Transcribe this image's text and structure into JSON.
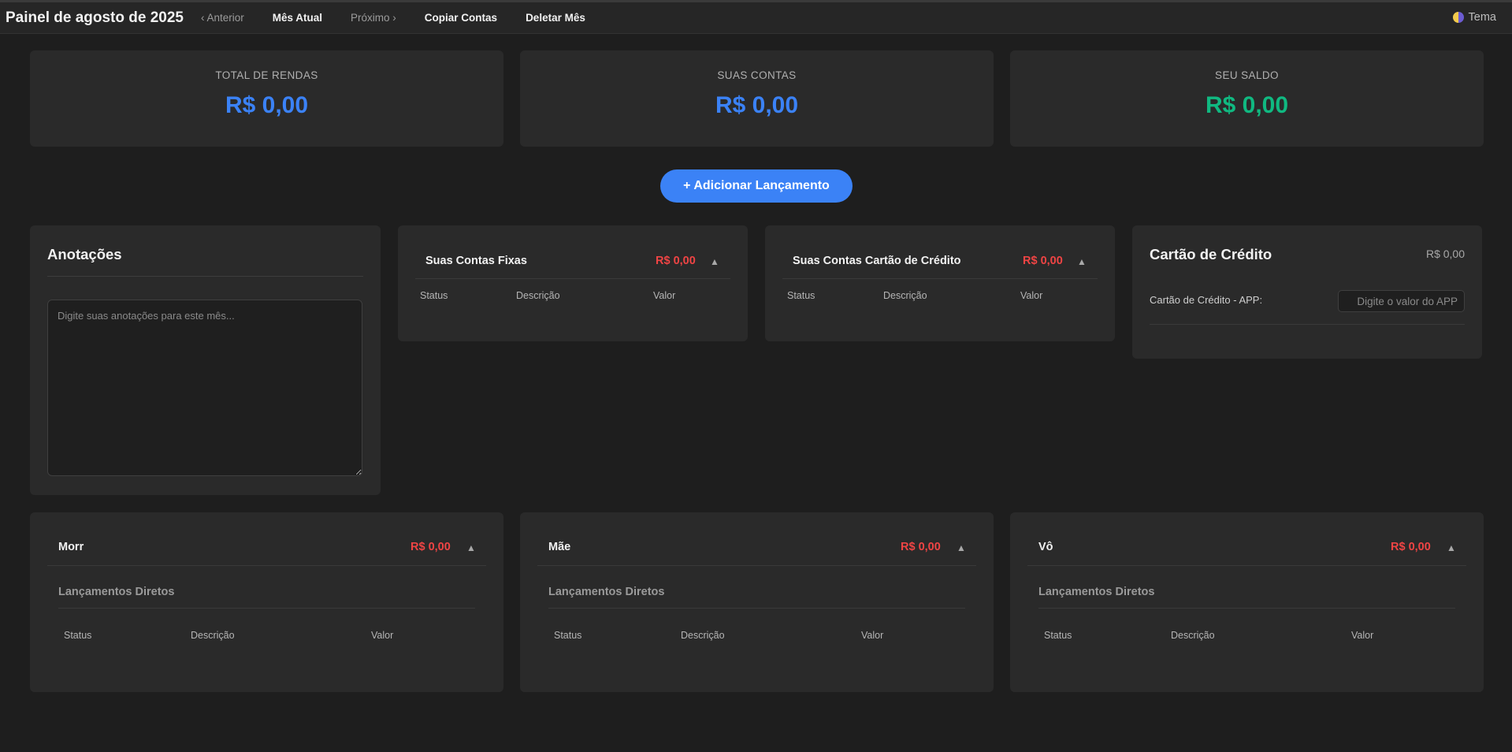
{
  "header": {
    "title": "Painel de agosto de 2025",
    "nav": {
      "previous": "‹ Anterior",
      "current": "Mês Atual",
      "next": "Próximo ›",
      "copy": "Copiar Contas",
      "delete": "Deletar Mês"
    },
    "theme_label": "Tema"
  },
  "summary": [
    {
      "label": "TOTAL DE RENDAS",
      "value": "R$ 0,00",
      "color": "#3b82f6"
    },
    {
      "label": "SUAS CONTAS",
      "value": "R$ 0,00",
      "color": "#3b82f6"
    },
    {
      "label": "SEU SALDO",
      "value": "R$ 0,00",
      "color": "#10b981"
    }
  ],
  "add_button": "+ Adicionar Lançamento",
  "notes": {
    "title": "Anotações",
    "placeholder": "Digite suas anotações para este mês..."
  },
  "fixed_bills": {
    "title": "Suas Contas Fixas",
    "total": "R$ 0,00",
    "columns": [
      "Status",
      "Descrição",
      "Valor"
    ]
  },
  "credit_bills": {
    "title": "Suas Contas Cartão de Crédito",
    "total": "R$ 0,00",
    "columns": [
      "Status",
      "Descrição",
      "Valor"
    ]
  },
  "credit_card": {
    "title": "Cartão de Crédito",
    "total": "R$ 0,00",
    "field_label": "Cartão de Crédito - APP:",
    "field_placeholder": "Digite o valor do APP"
  },
  "people": [
    {
      "name": "Morr",
      "total": "R$ 0,00",
      "subtitle": "Lançamentos Diretos",
      "columns": [
        "Status",
        "Descrição",
        "Valor"
      ]
    },
    {
      "name": "Mãe",
      "total": "R$ 0,00",
      "subtitle": "Lançamentos Diretos",
      "columns": [
        "Status",
        "Descrição",
        "Valor"
      ]
    },
    {
      "name": "Vô",
      "total": "R$ 0,00",
      "subtitle": "Lançamentos Diretos",
      "columns": [
        "Status",
        "Descrição",
        "Valor"
      ]
    }
  ],
  "colors": {
    "accent": "#3b82f6",
    "positive": "#10b981",
    "negative": "#ef4444"
  }
}
